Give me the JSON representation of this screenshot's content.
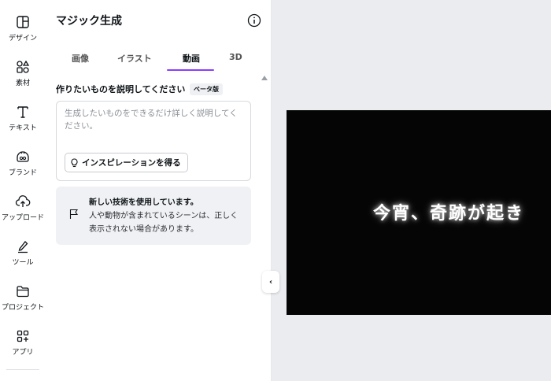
{
  "rail": {
    "items": [
      {
        "label": "デザイン",
        "icon": "layout-icon"
      },
      {
        "label": "素材",
        "icon": "elements-icon"
      },
      {
        "label": "テキスト",
        "icon": "text-icon"
      },
      {
        "label": "ブランド",
        "icon": "brand-icon"
      },
      {
        "label": "アップロード",
        "icon": "upload-icon"
      },
      {
        "label": "ツール",
        "icon": "draw-tool-icon"
      },
      {
        "label": "プロジェクト",
        "icon": "folder-icon"
      },
      {
        "label": "アプリ",
        "icon": "apps-icon"
      }
    ]
  },
  "panel": {
    "title": "マジック生成",
    "tabs": [
      {
        "label": "画像"
      },
      {
        "label": "イラスト"
      },
      {
        "label": "動画",
        "active": true
      },
      {
        "label": "3D"
      }
    ],
    "description_label": "作りたいものを説明してください",
    "beta_badge": "ベータ版",
    "prompt": {
      "value": "",
      "placeholder": "生成したいものをできるだけ詳しく説明してください。"
    },
    "inspiration_button": "インスピレーションを得る",
    "notice": {
      "title": "新しい技術を使用しています。",
      "body": "人や動物が含まれているシーンは、正しく表示されない場合があります。"
    }
  },
  "canvas": {
    "caption": "今宵、奇跡が起き"
  },
  "colors": {
    "accent": "#8b3dff",
    "canvas_bg": "#050505",
    "workspace_bg": "#ebecf0"
  }
}
